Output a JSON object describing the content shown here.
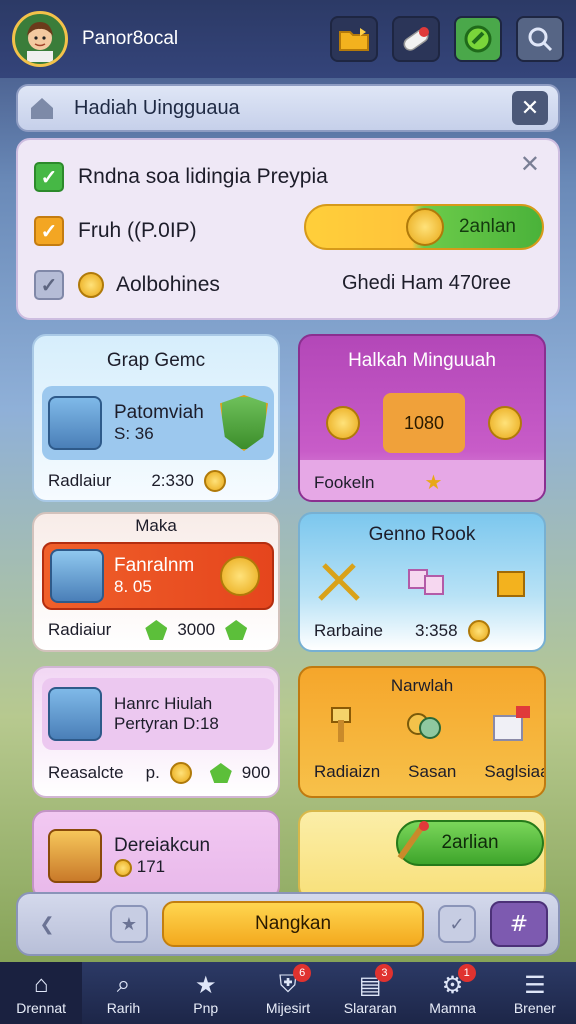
{
  "player": {
    "name": "Panor8ocal"
  },
  "header": {
    "title": "Hadiah Uingguaua"
  },
  "quest_panel": {
    "items": [
      {
        "label": "Rndna soa lidingia Preypia",
        "state": "checked"
      },
      {
        "label": "Fruh ((P.0IP)",
        "state": "pending"
      },
      {
        "label": "Aolbohines",
        "state": "locked"
      }
    ],
    "claim_label": "2anlan",
    "meta": "Ghedi Ham 470ree"
  },
  "cards": {
    "grap": {
      "title": "Grap Gemc",
      "line1": "Patomviah",
      "line2": "S: 36",
      "foot_label": "Radlaiur",
      "foot_value": "2:330"
    },
    "hadiah": {
      "title": "Halkah Minguuah",
      "foot_label": "Fookeln",
      "prize_center": "1080"
    },
    "maka": {
      "title": "Maka",
      "line1": "Fanralnm",
      "line2": "8. 05",
      "foot_label": "Radiaiur",
      "foot_value": "3000"
    },
    "book": {
      "title": "Genno Rook",
      "foot_label": "Rarbaine",
      "foot_value": "3:358"
    },
    "hanre": {
      "line1": "Hanrc Hiulah",
      "line2": "Pertyran D:18",
      "foot_label": "Reasalcte",
      "foot_value_a": "p.",
      "foot_value_b": "900"
    },
    "narwlah": {
      "title": "Narwlah",
      "foot_a": "Radiaizn",
      "foot_b": "Sasan",
      "foot_c": "Saglsiaa"
    },
    "derei": {
      "line1": "Dereiakcun",
      "line2": "171"
    },
    "claim": {
      "label": "2arlian"
    }
  },
  "bottom_bar": {
    "main_label": "Nangkan"
  },
  "navbar": {
    "items": [
      {
        "label": "Drennat",
        "icon": "home-icon",
        "badge": ""
      },
      {
        "label": "Rarih",
        "icon": "search-icon",
        "badge": ""
      },
      {
        "label": "Pnp",
        "icon": "star-icon",
        "badge": ""
      },
      {
        "label": "Mijesirt",
        "icon": "shield-icon",
        "badge": "6"
      },
      {
        "label": "Slararan",
        "icon": "cards-icon",
        "badge": "3"
      },
      {
        "label": "Mamna",
        "icon": "gear-icon",
        "badge": "1"
      },
      {
        "label": "Brener",
        "icon": "menu-icon",
        "badge": ""
      }
    ]
  },
  "colors": {
    "accent": "#f3c24a",
    "green": "#4ab23a",
    "purple": "#b347b8",
    "orange": "#f0a13a",
    "navy": "#2c3a66"
  }
}
